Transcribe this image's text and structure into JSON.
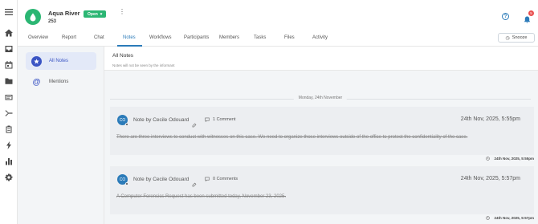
{
  "rail": {
    "icons": [
      "menu-icon",
      "home-icon",
      "inbox-icon",
      "calendar-icon",
      "folder-icon",
      "card-icon",
      "merge-icon",
      "clipboard-icon",
      "bolt-icon",
      "bar-chart-icon",
      "gear-icon"
    ]
  },
  "header": {
    "title": "Aqua River",
    "number": "253",
    "status": "Open",
    "notification_count": "5"
  },
  "tabs": [
    "Overview",
    "Report",
    "Chat",
    "Notes",
    "Workflows",
    "Participants",
    "Members",
    "Tasks",
    "Files",
    "Activity"
  ],
  "active_tab": "Notes",
  "snooze_label": "Snooze",
  "sidebar": {
    "items": [
      {
        "label": "All Notes",
        "icon": "star-icon"
      },
      {
        "label": "Mentions",
        "icon": "at-icon"
      }
    ]
  },
  "main": {
    "title": "All Notes",
    "subtitle": "Notes will not be seen by the informant",
    "date_separator": "Monday, 24th November",
    "notes": [
      {
        "initials": "CO",
        "author": "Note by Cecile Odouard",
        "comments": "1 Comment",
        "date": "24th Nov, 2025, 5:55pm",
        "body": "There are three interviews to conduct with witnesses on this case. We need to organize those interviews outside of the office to protect the confidentiality of the case.",
        "stamp": "24th Nov, 2025, 5:55pm"
      },
      {
        "initials": "CO",
        "author": "Note by Cecile Odouard",
        "comments": "0 Comments",
        "date": "24th Nov, 2025, 5:57pm",
        "body": "A Computer Forensics Request has been submitted today, November 23, 2025.",
        "stamp": "24th Nov, 2025, 5:57pm"
      }
    ]
  },
  "colors": {
    "accent": "#2b7bb9",
    "status_green": "#2bb673",
    "sidebar_accent": "#3a54c4",
    "badge_red": "#e94f4f"
  }
}
